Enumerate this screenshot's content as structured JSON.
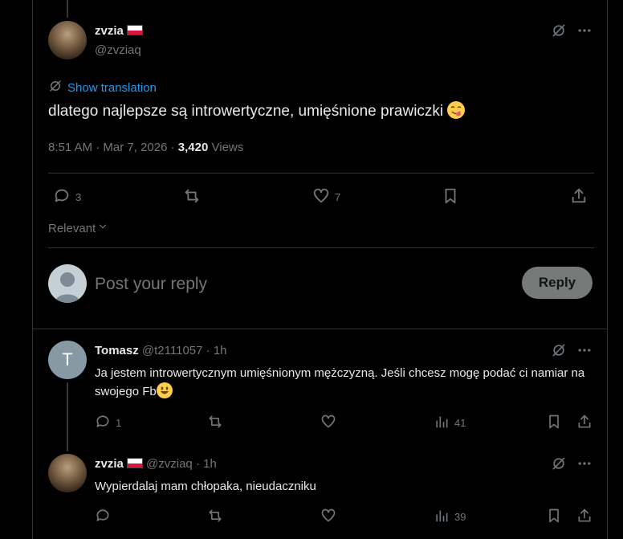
{
  "main_post": {
    "name": "zvzia",
    "handle": "@zvziaq",
    "show_translation": "Show translation",
    "text": "dlatego najlepsze są introwertyczne, umięśnione prawiczki",
    "time": "8:51 AM",
    "date": "Mar 7, 2026",
    "views_count": "3,420",
    "views_label": "Views",
    "replies": "3",
    "likes": "7"
  },
  "sort": {
    "label": "Relevant"
  },
  "composer": {
    "placeholder": "Post your reply",
    "reply_button": "Reply"
  },
  "replies": [
    {
      "name": "Tomasz",
      "handle": "@t2111057",
      "time": "1h",
      "avatar_letter": "T",
      "text": "Ja jestem introwertycznym umięśnionym mężczyzną. Jeśli chcesz mogę podać ci namiar na swojego Fb",
      "replies": "1",
      "views": "41"
    },
    {
      "name": "zvzia",
      "handle": "@zvziaq",
      "time": "1h",
      "text": "Wypierdalaj mam chłopaka, nieudaczniku",
      "views": "39"
    }
  ],
  "meta": {
    "separator": "·"
  },
  "colors": {
    "link": "#1d9bf0",
    "muted": "#71767b",
    "avatar_t": "#8899a6",
    "flag_red": "#dc143c",
    "emoji": "#ffcc4d"
  },
  "icons": [
    "translate-icon",
    "more-icon",
    "reply-icon",
    "repost-icon",
    "like-icon",
    "bookmark-icon",
    "share-icon",
    "views-icon",
    "chevron-down-icon"
  ]
}
